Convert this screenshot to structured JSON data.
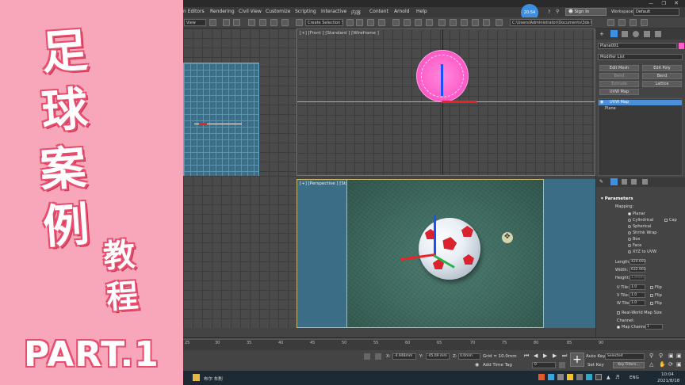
{
  "promo": {
    "title_chars": [
      "足",
      "球",
      "案",
      "例"
    ],
    "subtitle_chars": [
      "教",
      "程"
    ],
    "part": "PART.1"
  },
  "menu": {
    "items": [
      "n Editors",
      "Rendering",
      "Civil View",
      "Customize",
      "Scripting",
      "Interactive",
      "内容",
      "Content",
      "Arnold",
      "Help"
    ],
    "badge": "20:54",
    "sign_in": "Sign In",
    "workspaces_label": "Workspaces:",
    "workspaces_value": "Default"
  },
  "toolbar": {
    "view_select": "View",
    "selection_set": "Create Selection Set",
    "path": "C:\\Users\\Administrator\\Documents\\3ds Max 2020"
  },
  "viewports": {
    "front": "[+] [Front ] [Standard ] [Wireframe ]",
    "perspective": "[+] [Perspective ] [Standard ] [Default Shading ]"
  },
  "command_panel": {
    "object_name": "Plane001",
    "modifier_list": "Modifier List",
    "buttons": [
      "Edit Mesh",
      "Edit Poly",
      "Bend",
      "Bend",
      "Extrude",
      "Lattice",
      "UVW Map"
    ],
    "stack": [
      "UVW Map",
      "Plane"
    ],
    "rollout_title": "Parameters",
    "mapping_label": "Mapping:",
    "mapping_options": [
      "Planar",
      "Cylindrical",
      "Cap",
      "Spherical",
      "Shrink Wrap",
      "Box",
      "Face",
      "XYZ to UVW"
    ],
    "fields": [
      {
        "label": "Length:",
        "value": "420.693"
      },
      {
        "label": "Width:",
        "value": "632.903"
      },
      {
        "label": "Height:",
        "value": "1.0mm"
      },
      {
        "label": "U Tile:",
        "value": "1.0",
        "flip": "Flip"
      },
      {
        "label": "V Tile:",
        "value": "1.0",
        "flip": "Flip"
      },
      {
        "label": "W Tile:",
        "value": "1.0",
        "flip": "Flip"
      }
    ],
    "real_world": "Real-World Map Size",
    "channel_label": "Channel:",
    "map_channel": "Map Channel:",
    "map_channel_value": "1"
  },
  "timeline": {
    "ticks": [
      "25",
      "30",
      "35",
      "40",
      "45",
      "50",
      "55",
      "60",
      "65",
      "70",
      "75",
      "80",
      "85",
      "90"
    ]
  },
  "status": {
    "x_label": "X:",
    "x_value": "-4.948mm",
    "y_label": "Y:",
    "y_value": "-45.09 mm",
    "z_label": "Z:",
    "z_value": "0.0mm",
    "grid": "Grid = 10.0mm",
    "add_time_tag": "Add Time Tag",
    "auto_key": "Auto Key",
    "set_key": "Set Key",
    "selected": "Selected",
    "key_filters": "Key Filters...",
    "frame": "0"
  },
  "taskbar": {
    "app_label": "布尔 车削",
    "time": "10:04",
    "date": "2021/8/18",
    "lang": "ENG"
  },
  "colors": {
    "promo_bg": "#f7a7b9",
    "accent": "#e84d6d",
    "sphere_pink": "#ff5fc9",
    "plane_blue": "#3b6d86"
  }
}
